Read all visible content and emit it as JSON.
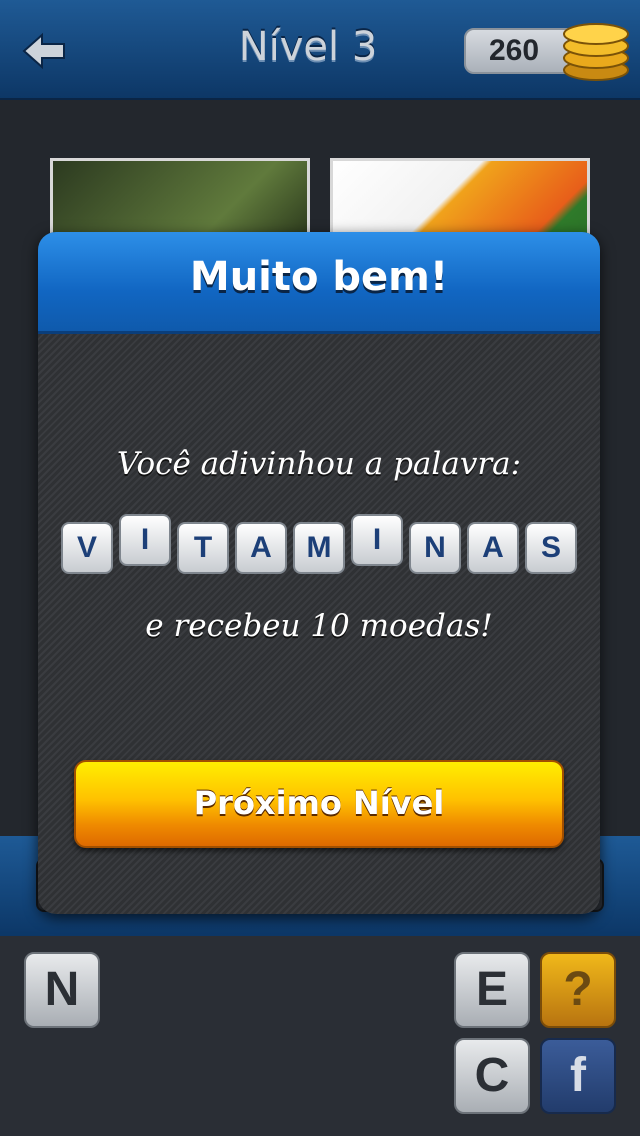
{
  "header": {
    "title": "Nível 3",
    "coins": "260"
  },
  "dialog": {
    "title": "Muito bem!",
    "message": "Você adivinhou a palavra:",
    "word_letters": [
      "V",
      "I",
      "T",
      "A",
      "M",
      "I",
      "N",
      "A",
      "S"
    ],
    "reward": "e recebeu 10 moedas!",
    "next_button": "Próximo Nível"
  },
  "letters": {
    "left": [
      "N"
    ],
    "right": [
      "E",
      "C"
    ]
  },
  "actions": {
    "help": "?",
    "facebook": "f"
  }
}
